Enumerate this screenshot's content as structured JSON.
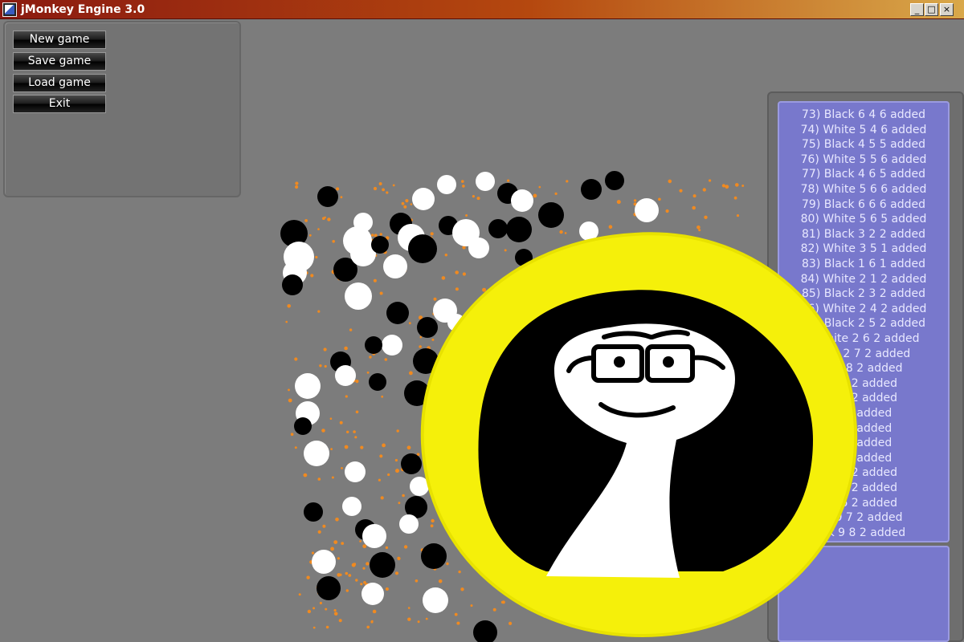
{
  "window": {
    "title": "jMonkey Engine 3.0",
    "minimize": "_",
    "maximize": "□",
    "close": "×"
  },
  "menu": {
    "new_game": "New game",
    "save_game": "Save game",
    "load_game": "Load game",
    "exit": "Exit"
  },
  "log": [
    "73) Black 6 4 6 added",
    "74) White 5 4 6 added",
    "75) Black 4 5 5 added",
    "76) White 5 5 6 added",
    "77) Black 4 6 5 added",
    "78) White 5 6 6 added",
    "79) Black 6 6 6 added",
    "80) White 5 6 5 added",
    "81) Black 3 2 2 added",
    "82) White 3 5 1 added",
    "83) Black 1 6 1 added",
    "84) White 2 1 2 added",
    "85) Black 2 3 2 added",
    "86) White 2 4 2 added",
    "87) Black 2 5 2 added",
    ") White 2 6 2 added",
    "lack 2 7 2 added",
    "e 2 8 2 added",
    "3 6 2 added",
    "3 8 2 added",
    "9 2 added",
    "8 2 added",
    "7 2 added",
    "8 2 added",
    "5 7 2 added",
    "7 6 2 added",
    "8 6 2 added",
    "e 9 7 2 added",
    "ck 9 8 2 added"
  ],
  "colors": {
    "background": "#7c7c7c",
    "log_panel": "#7878cc",
    "stone_white": "#ffffff",
    "stone_black": "#000000",
    "dot": "#f08a20",
    "highlight": "#f5f00a"
  },
  "icons": [
    "app-icon",
    "minimize-icon",
    "maximize-icon",
    "close-icon"
  ]
}
